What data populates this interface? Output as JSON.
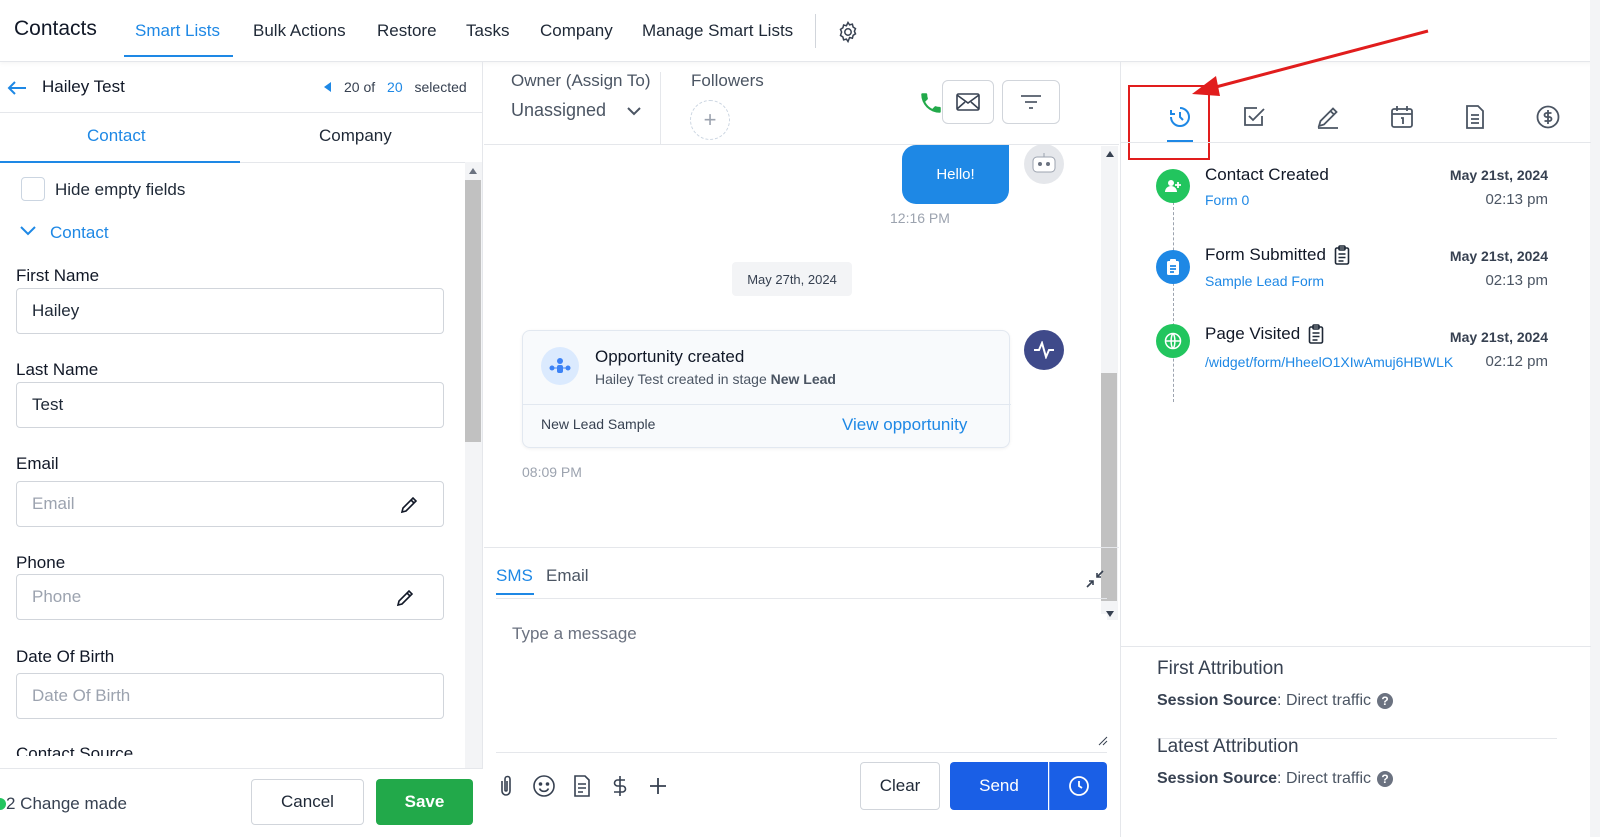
{
  "nav": {
    "title": "Contacts",
    "items": [
      "Smart Lists",
      "Bulk Actions",
      "Restore",
      "Tasks",
      "Company",
      "Manage Smart Lists"
    ],
    "active_index": 0
  },
  "left": {
    "contact_name": "Hailey Test",
    "pager": {
      "current": "20",
      "of": "of",
      "total": "20",
      "suffix": "selected"
    },
    "tabs": [
      "Contact",
      "Company"
    ],
    "hide_empty_label": "Hide empty fields",
    "section_title": "Contact",
    "fields": [
      {
        "label": "First Name",
        "value": "Hailey",
        "placeholder": ""
      },
      {
        "label": "Last Name",
        "value": "Test",
        "placeholder": ""
      },
      {
        "label": "Email",
        "value": "",
        "placeholder": "Email"
      },
      {
        "label": "Phone",
        "value": "",
        "placeholder": "Phone"
      },
      {
        "label": "Date Of Birth",
        "value": "",
        "placeholder": "Date Of Birth"
      },
      {
        "label": "Contact Source",
        "value": "",
        "placeholder": ""
      }
    ],
    "footer": {
      "changes": "2 Change made",
      "cancel": "Cancel",
      "save": "Save"
    }
  },
  "mid": {
    "owner_label": "Owner (Assign To)",
    "owner_value": "Unassigned",
    "followers_label": "Followers",
    "message": {
      "text": "Hello!",
      "time": "12:16 PM"
    },
    "date_divider": "May 27th, 2024",
    "opportunity": {
      "title": "Opportunity created",
      "sub_prefix": "Hailey Test created in stage ",
      "stage": "New Lead",
      "name": "New Lead Sample",
      "link": "View opportunity",
      "time": "08:09 PM"
    },
    "composer": {
      "tabs": [
        "SMS",
        "Email"
      ],
      "placeholder": "Type a message",
      "clear": "Clear",
      "send": "Send"
    }
  },
  "right": {
    "timeline": [
      {
        "title": "Contact Created",
        "link": "Form 0",
        "date": "May 21st, 2024",
        "time": "02:13 pm",
        "color": "#22c55e",
        "icon": "user-plus-icon"
      },
      {
        "title": "Form Submitted",
        "link": "Sample Lead Form",
        "date": "May 21st, 2024",
        "time": "02:13 pm",
        "color": "#1e88e5",
        "icon": "clipboard-icon"
      },
      {
        "title": "Page Visited",
        "link": "/widget/form/HheelO1XIwAmuj6HBWLK",
        "date": "May 21st, 2024",
        "time": "02:12 pm",
        "color": "#22c55e",
        "icon": "globe-icon"
      }
    ],
    "first_attribution": {
      "title": "First Attribution",
      "key": "Session Source",
      "value": "Direct traffic"
    },
    "latest_attribution": {
      "title": "Latest Attribution",
      "key": "Session Source",
      "value": "Direct traffic"
    }
  },
  "colors": {
    "accent": "#1e88e5",
    "save_green": "#22a94a",
    "send_blue": "#1a5fe6",
    "annotation_red": "#e11d1d"
  }
}
